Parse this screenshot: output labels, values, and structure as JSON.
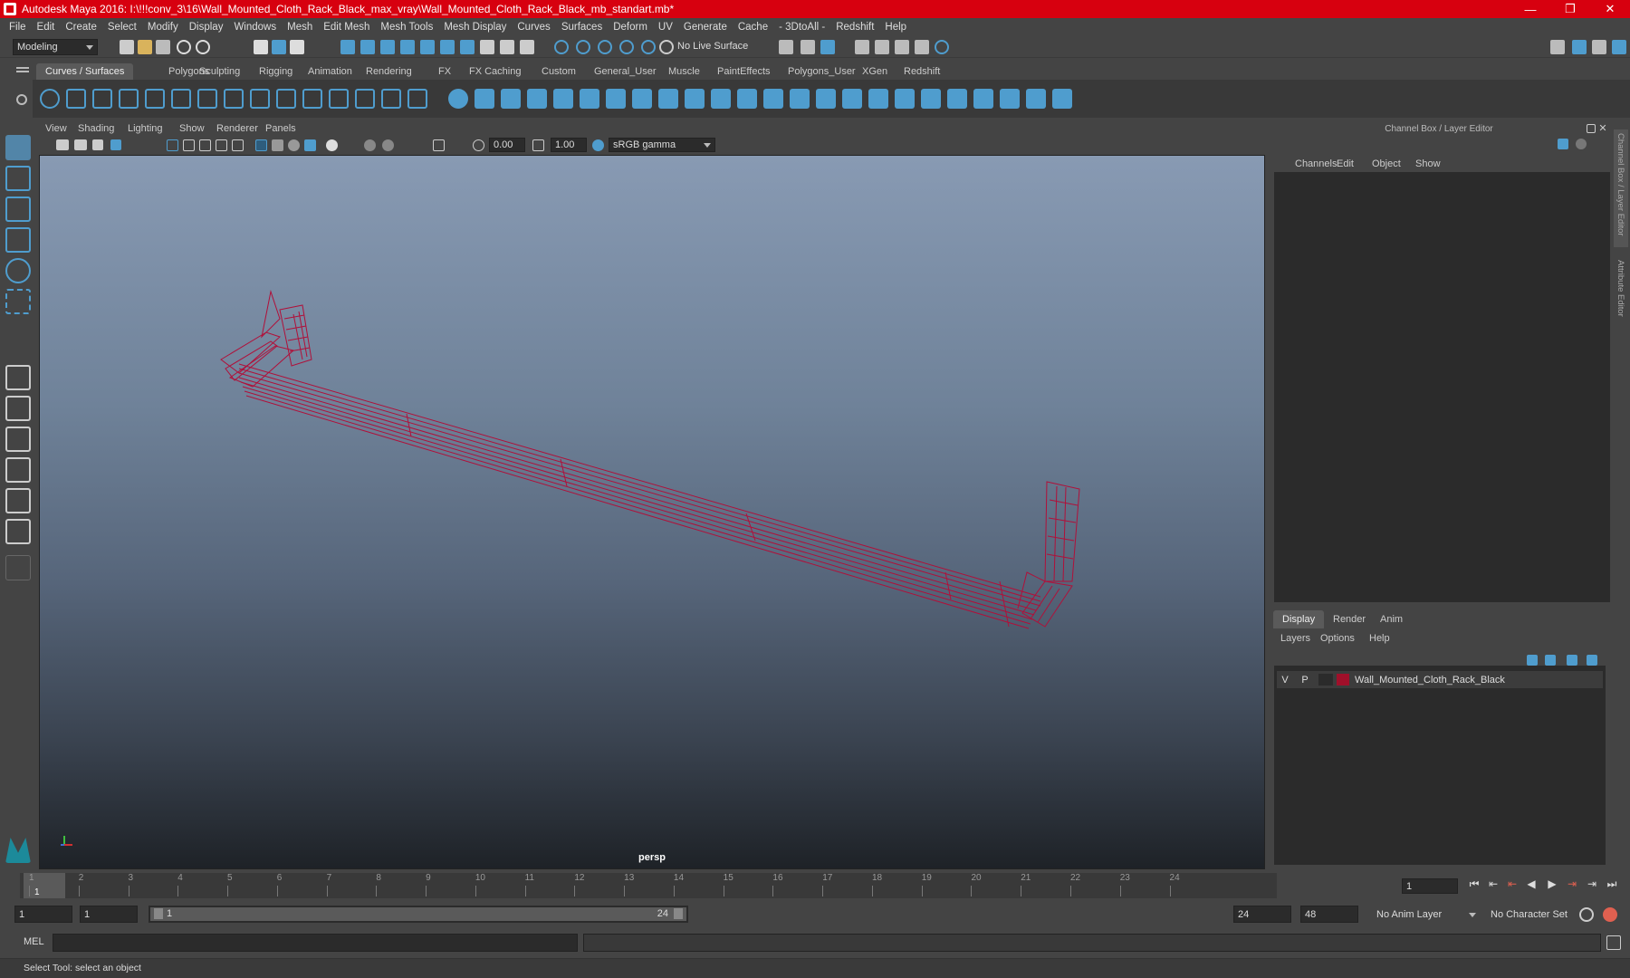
{
  "window": {
    "title": "Autodesk Maya 2016: I:\\!!!conv_3\\16\\Wall_Mounted_Cloth_Rack_Black_max_vray\\Wall_Mounted_Cloth_Rack_Black_mb_standart.mb*",
    "minimize": "—",
    "restore": "❐",
    "close": "✕"
  },
  "menu": [
    "File",
    "Edit",
    "Create",
    "Select",
    "Modify",
    "Display",
    "Windows",
    "Mesh",
    "Edit Mesh",
    "Mesh Tools",
    "Mesh Display",
    "Curves",
    "Surfaces",
    "Deform",
    "UV",
    "Generate",
    "Cache",
    "- 3DtoAll -",
    "Redshift",
    "Help"
  ],
  "statusline": {
    "mode": "Modeling",
    "live_surface": "No Live Surface"
  },
  "shelf_tabs": [
    "Curves / Surfaces",
    "Polygons",
    "Sculpting",
    "Rigging",
    "Animation",
    "Rendering",
    "FX",
    "FX Caching",
    "Custom",
    "General_User",
    "Muscle",
    "PaintEffects",
    "Polygons_User",
    "XGen",
    "Redshift"
  ],
  "shelf_active": "Curves / Surfaces",
  "viewport": {
    "menu": [
      "View",
      "Shading",
      "Lighting",
      "Show",
      "Renderer",
      "Panels"
    ],
    "exposure": "0.00",
    "gamma": "1.00",
    "colorspace": "sRGB gamma",
    "camera": "persp"
  },
  "channel_box": {
    "title": "Channel Box / Layer Editor",
    "menu": [
      "Channels",
      "Edit",
      "Object",
      "Show"
    ]
  },
  "layer_editor": {
    "tabs": [
      "Display",
      "Render",
      "Anim"
    ],
    "active_tab": "Display",
    "menu": [
      "Layers",
      "Options",
      "Help"
    ],
    "layer": {
      "v": "V",
      "p": "P",
      "name": "Wall_Mounted_Cloth_Rack_Black",
      "color": "#a0102a"
    }
  },
  "side_tabs": [
    "Channel Box / Layer Editor",
    "Attribute Editor"
  ],
  "timeline": {
    "ticks": [
      "1",
      "2",
      "3",
      "4",
      "5",
      "6",
      "7",
      "8",
      "9",
      "10",
      "11",
      "12",
      "13",
      "14",
      "15",
      "16",
      "17",
      "18",
      "19",
      "20",
      "21",
      "22",
      "23",
      "24"
    ],
    "current": "1",
    "current_field": "1"
  },
  "range": {
    "start": "1",
    "start2": "1",
    "slider_start": "1",
    "slider_end": "24",
    "end": "24",
    "end2": "48",
    "anim_layer": "No Anim Layer",
    "char_set": "No Character Set"
  },
  "cmd": {
    "label": "MEL"
  },
  "help": "Select Tool: select an object",
  "colors": {
    "titlebar": "#d7000f",
    "wireframe": "#b0103a",
    "accent": "#4f9dce"
  }
}
